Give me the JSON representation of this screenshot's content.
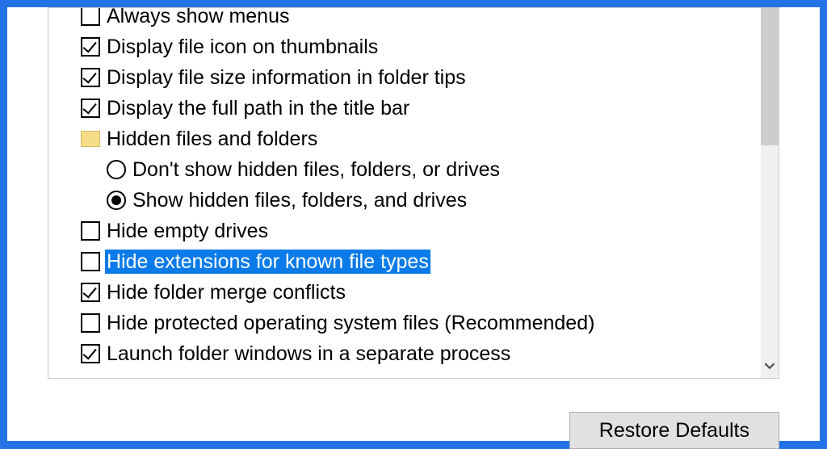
{
  "options": {
    "always_show_menus": "Always show menus",
    "display_file_icon": "Display file icon on thumbnails",
    "display_file_size": "Display file size information in folder tips",
    "display_full_path": "Display the full path in the title bar",
    "hidden_group": "Hidden files and folders",
    "dont_show_hidden": "Don't show hidden files, folders, or drives",
    "show_hidden": "Show hidden files, folders, and drives",
    "hide_empty": "Hide empty drives",
    "hide_extensions": "Hide extensions for known file types",
    "hide_merge": "Hide folder merge conflicts",
    "hide_protected": "Hide protected operating system files (Recommended)",
    "launch_separate": "Launch folder windows in a separate process"
  },
  "buttons": {
    "restore_defaults": "Restore Defaults"
  }
}
